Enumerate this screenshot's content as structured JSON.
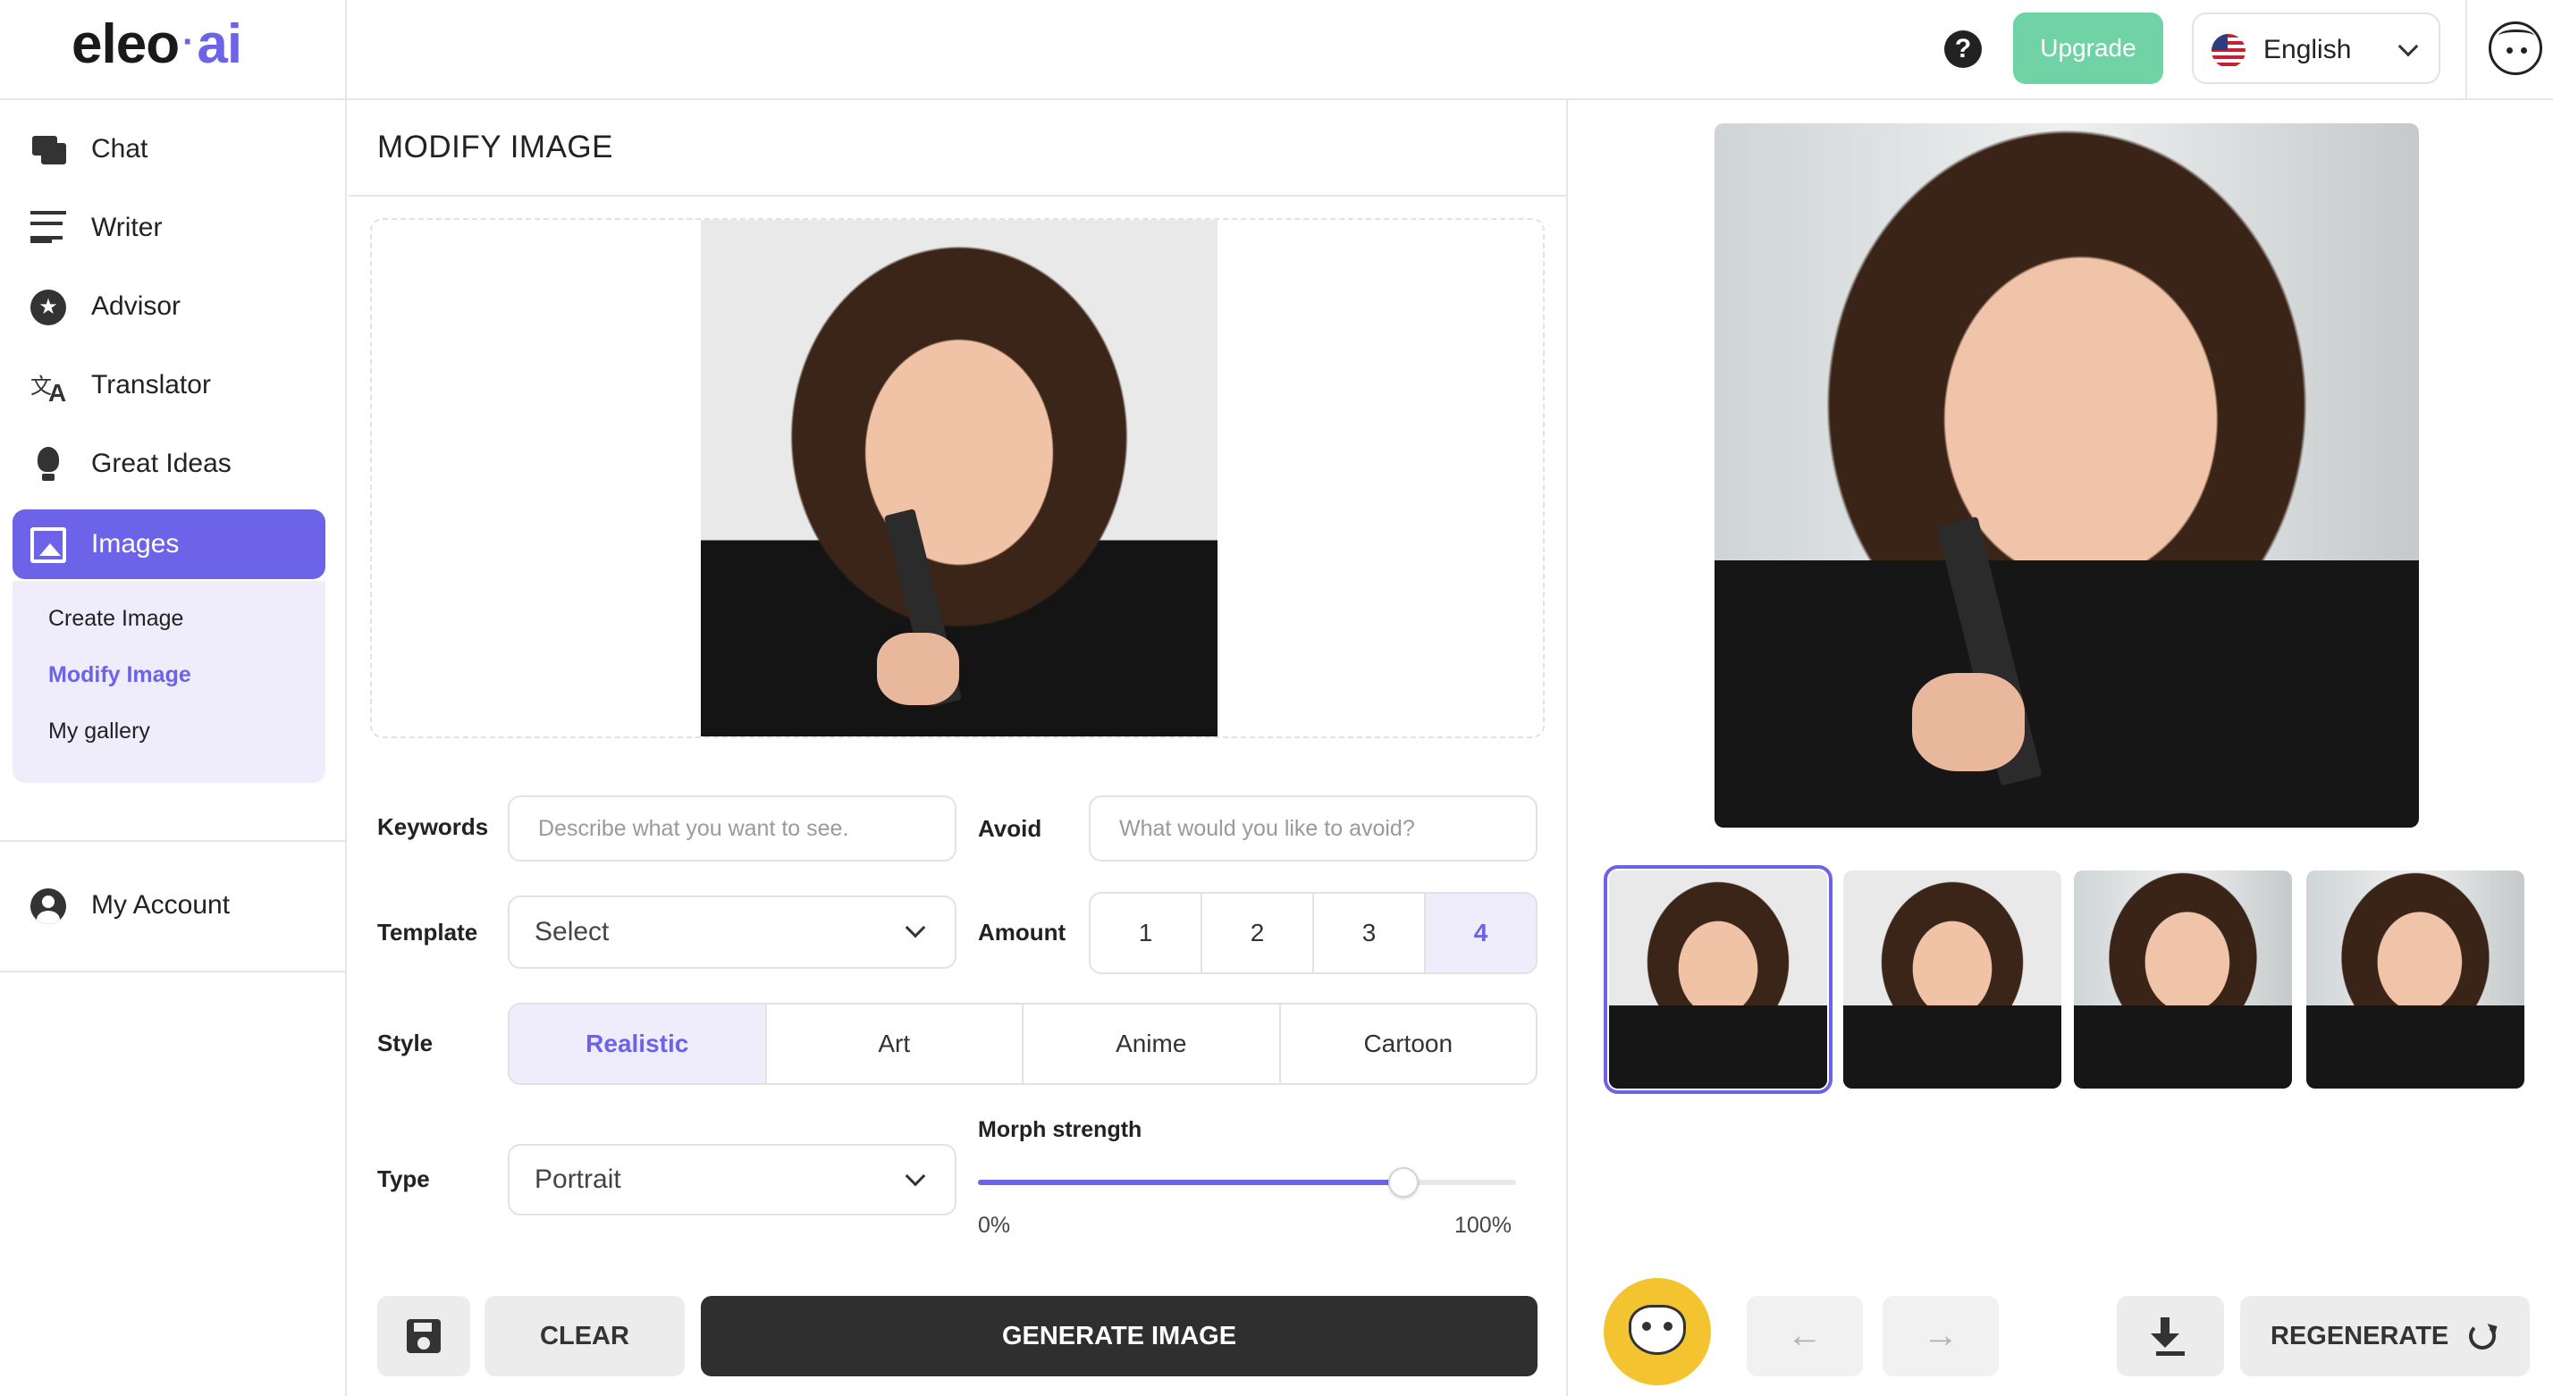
{
  "header": {
    "logo_main": "eleo",
    "logo_sep": "·",
    "logo_ai": "ai",
    "help_label": "?",
    "upgrade_label": "Upgrade",
    "language": "English",
    "icons": {
      "help": "help-icon",
      "flag": "us-flag-icon",
      "avatar": "avatar-icon"
    }
  },
  "sidebar": {
    "items": [
      {
        "label": "Chat",
        "icon": "chat-icon"
      },
      {
        "label": "Writer",
        "icon": "writer-icon"
      },
      {
        "label": "Advisor",
        "icon": "advisor-icon"
      },
      {
        "label": "Translator",
        "icon": "translator-icon"
      },
      {
        "label": "Great Ideas",
        "icon": "lightbulb-icon"
      },
      {
        "label": "Images",
        "icon": "image-icon",
        "active": true
      }
    ],
    "sub_items": [
      {
        "label": "Create Image"
      },
      {
        "label": "Modify Image",
        "active": true
      },
      {
        "label": "My gallery"
      }
    ],
    "account": {
      "label": "My Account",
      "icon": "account-icon"
    }
  },
  "main": {
    "title": "MODIFY IMAGE",
    "keywords_label": "Keywords",
    "keywords_placeholder": "Describe what you want to see.",
    "avoid_label": "Avoid",
    "avoid_placeholder": "What would you like to avoid?",
    "template_label": "Template",
    "template_value": "Select",
    "amount_label": "Amount",
    "amount_options": [
      "1",
      "2",
      "3",
      "4"
    ],
    "amount_selected": "4",
    "style_label": "Style",
    "style_options": [
      "Realistic",
      "Art",
      "Anime",
      "Cartoon"
    ],
    "style_selected": "Realistic",
    "type_label": "Type",
    "type_value": "Portrait",
    "morph_label": "Morph strength",
    "morph_min": "0%",
    "morph_max": "100%",
    "morph_value": 0.79,
    "clear_label": "CLEAR",
    "generate_label": "GENERATE IMAGE"
  },
  "result": {
    "thumb_count": 4,
    "selected_thumb": 1,
    "regenerate_label": "REGENERATE",
    "prev_icon": "←",
    "next_icon": "→"
  },
  "colors": {
    "accent": "#6c63e8",
    "upgrade": "#6fd3a6",
    "owl": "#f4c430",
    "dark_button": "#2f2f2f"
  }
}
